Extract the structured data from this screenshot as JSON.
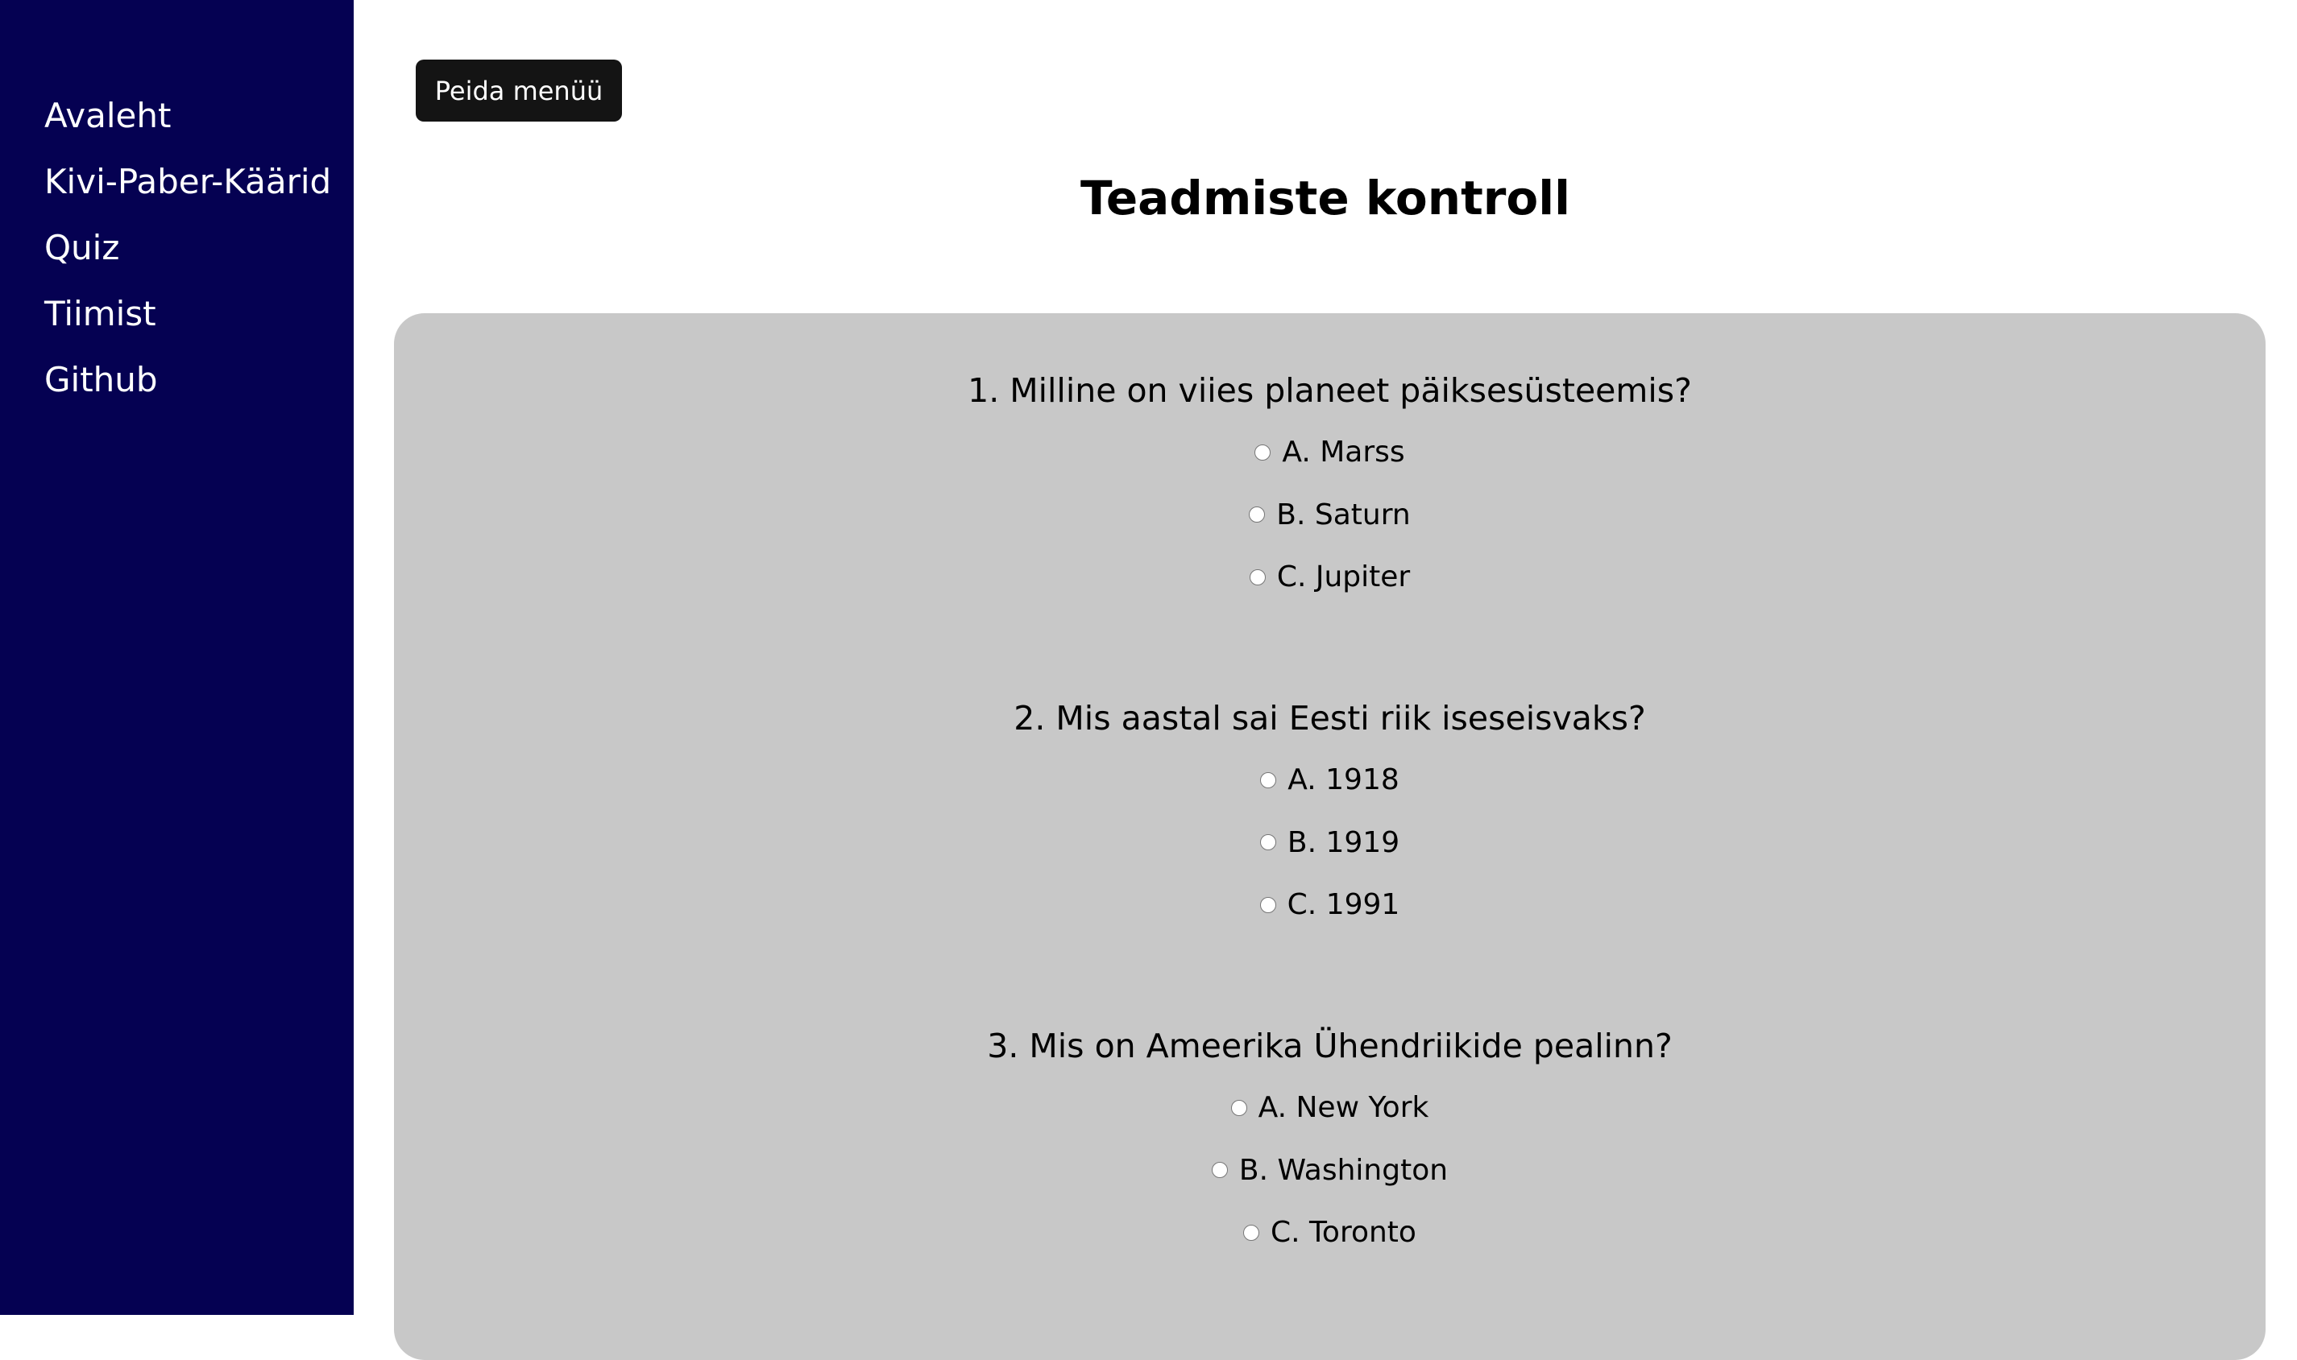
{
  "sidebar": {
    "items": [
      {
        "label": "Avaleht"
      },
      {
        "label": "Kivi-Paber-Käärid"
      },
      {
        "label": "Quiz"
      },
      {
        "label": "Tiimist"
      },
      {
        "label": "Github"
      }
    ]
  },
  "toolbar": {
    "toggle_menu_label": "Peida menüü"
  },
  "page": {
    "title": "Teadmiste kontroll"
  },
  "quiz": {
    "questions": [
      {
        "text": "1. Milline on viies planeet päiksesüsteemis?",
        "options": [
          {
            "label": "A. Marss"
          },
          {
            "label": "B. Saturn"
          },
          {
            "label": "C. Jupiter"
          }
        ]
      },
      {
        "text": "2. Mis aastal sai Eesti riik iseseisvaks?",
        "options": [
          {
            "label": "A. 1918"
          },
          {
            "label": "B. 1919"
          },
          {
            "label": "C. 1991"
          }
        ]
      },
      {
        "text": "3. Mis on Ameerika Ühendriikide pealinn?",
        "options": [
          {
            "label": "A. New York"
          },
          {
            "label": "B. Washington"
          },
          {
            "label": "C. Toronto"
          }
        ]
      }
    ]
  },
  "colors": {
    "sidebar_bg": "#050152",
    "button_bg": "#141414",
    "panel_bg": "#c8c8c8"
  }
}
